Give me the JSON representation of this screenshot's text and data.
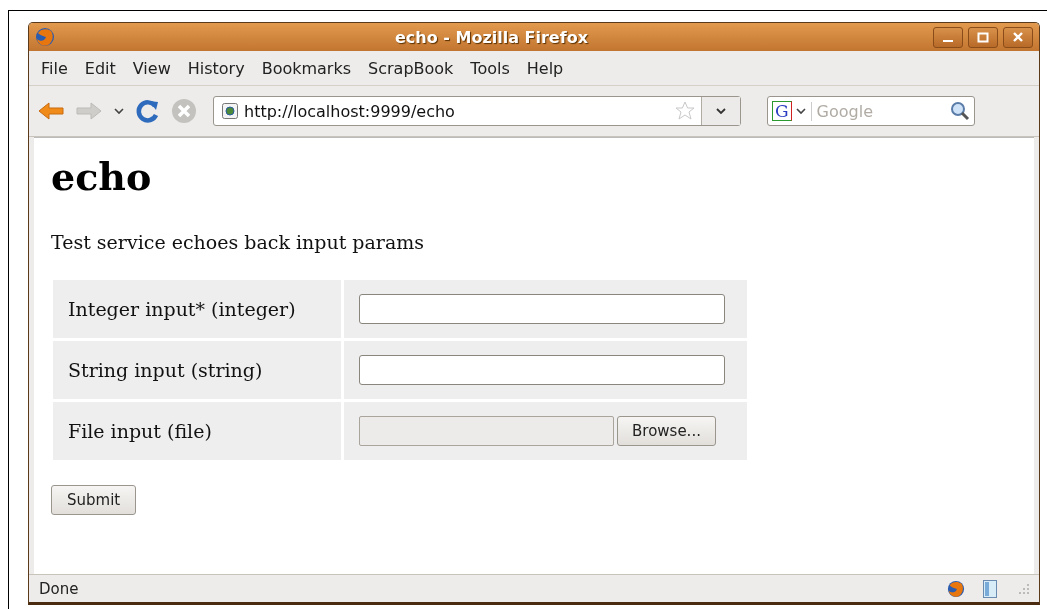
{
  "window": {
    "title": "echo - Mozilla Firefox"
  },
  "menu": [
    "File",
    "Edit",
    "View",
    "History",
    "Bookmarks",
    "ScrapBook",
    "Tools",
    "Help"
  ],
  "toolbar": {
    "back_disabled": false,
    "forward_disabled": true,
    "stop_disabled": true,
    "url": "http://localhost:9999/echo",
    "search_engine": "G",
    "search_placeholder": "Google"
  },
  "page": {
    "heading": "echo",
    "description": "Test service echoes back input params",
    "fields": [
      {
        "label": "Integer input* (integer)",
        "kind": "text"
      },
      {
        "label": "String input (string)",
        "kind": "text"
      },
      {
        "label": "File input (file)",
        "kind": "file",
        "button": "Browse..."
      }
    ],
    "submit": "Submit"
  },
  "status_bar": {
    "text": "Done"
  }
}
